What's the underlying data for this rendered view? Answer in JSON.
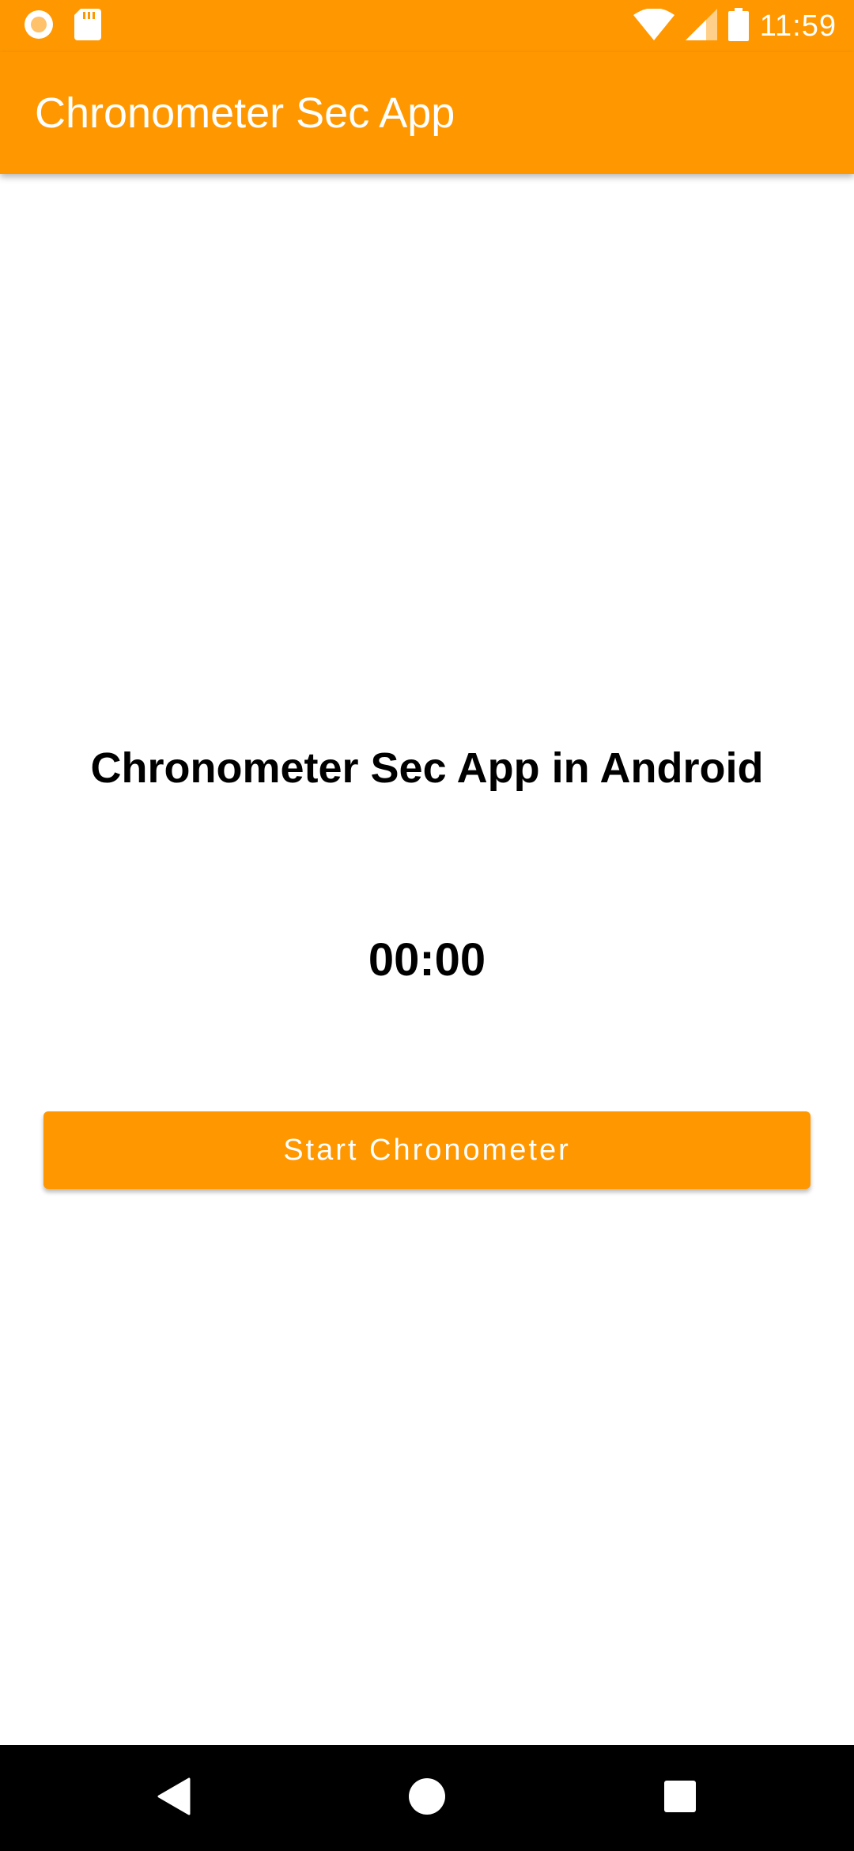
{
  "status_bar": {
    "time": "11:59",
    "icons": [
      "notification-circle-icon",
      "sd-card-icon",
      "wifi-icon",
      "signal-icon",
      "battery-icon"
    ]
  },
  "app_bar": {
    "title": "Chronometer Sec App"
  },
  "main": {
    "heading": "Chronometer Sec App in Android",
    "chronometer_value": "00:00",
    "start_button_label": "Start Chronometer"
  },
  "nav_bar": {
    "buttons": [
      "back-icon",
      "home-icon",
      "recents-icon"
    ]
  },
  "colors": {
    "primary": "#ff9800",
    "on_primary": "#ffffff",
    "text": "#000000",
    "nav_background": "#000000"
  }
}
